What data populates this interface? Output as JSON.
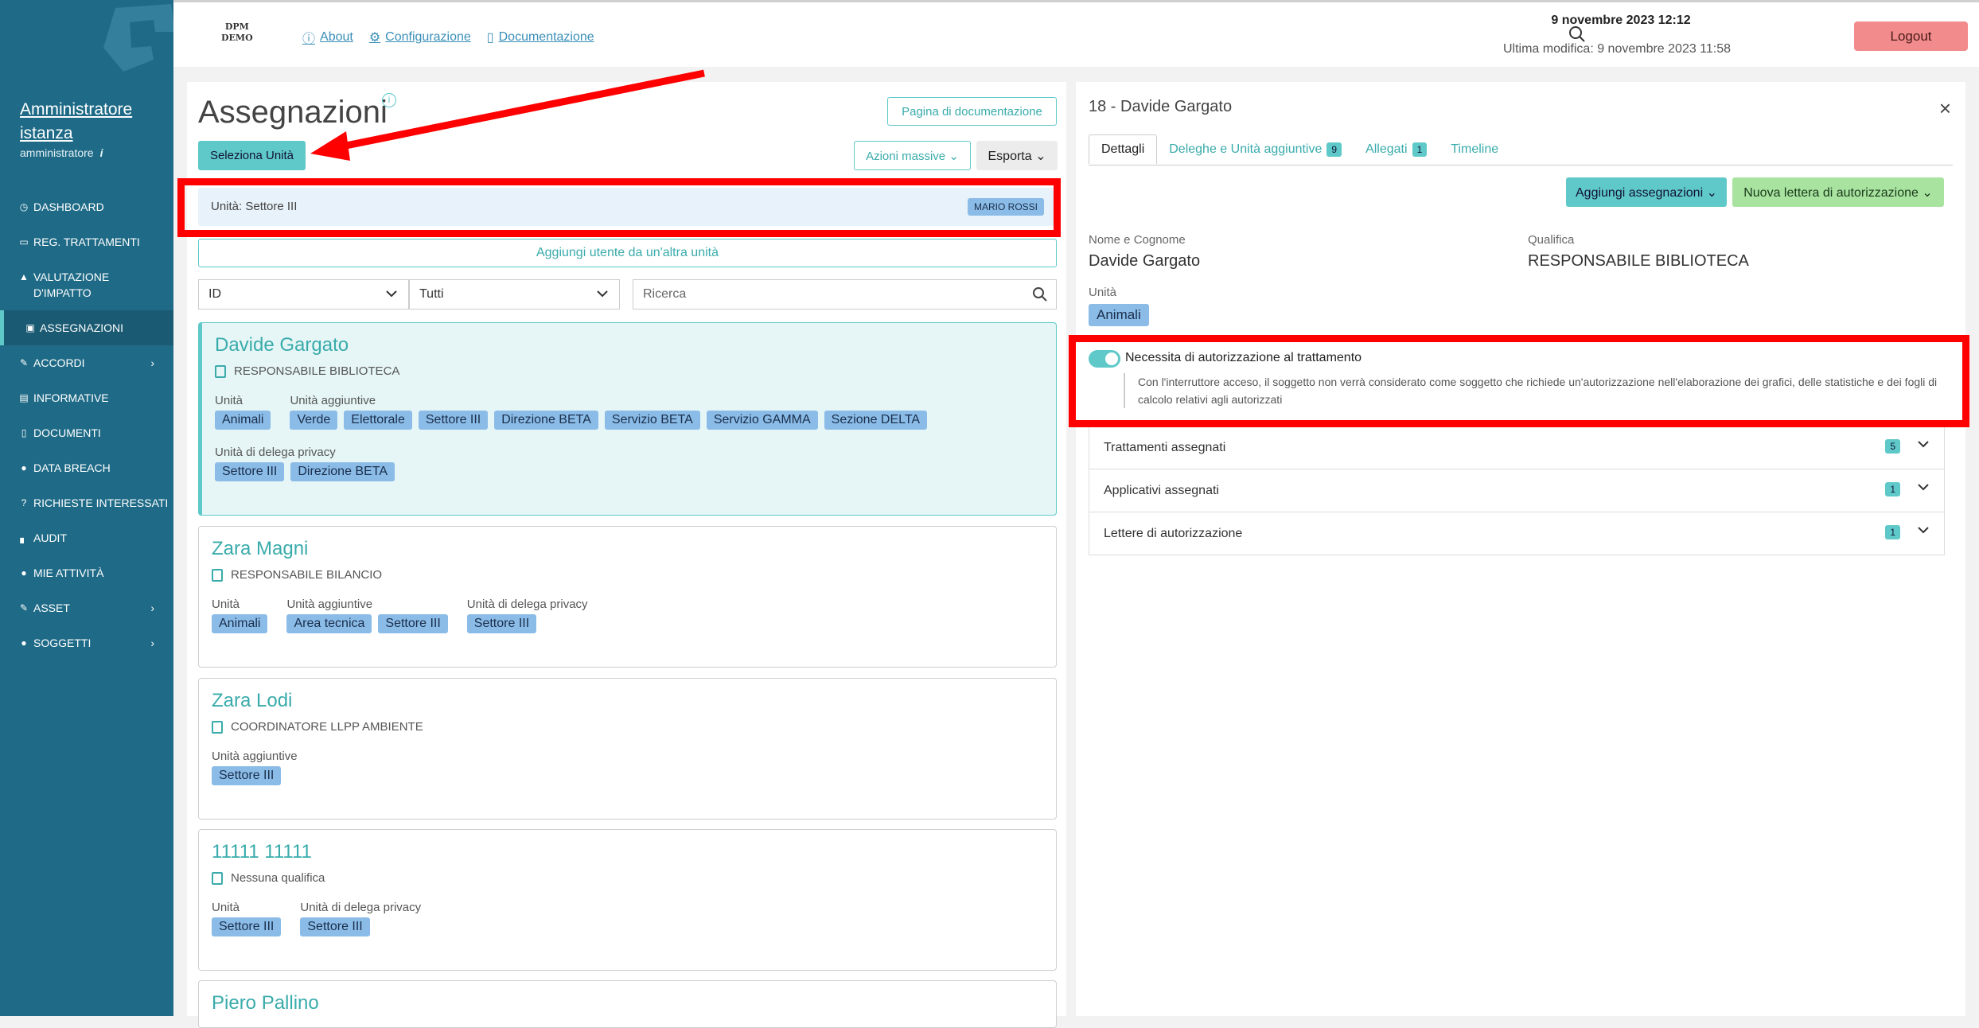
{
  "brand": {
    "line1": "DPM",
    "line2": "DEMO"
  },
  "topbar": {
    "links": [
      {
        "label": "About",
        "icon": "info-icon"
      },
      {
        "label": "Configurazione",
        "icon": "gear-icon"
      },
      {
        "label": "Documentazione",
        "icon": "book-icon"
      }
    ],
    "date": "9 novembre 2023 12:12",
    "last_modified": "Ultima modifica: 9 novembre 2023 11:58",
    "logout_label": "Logout"
  },
  "sidebar": {
    "user_name": "Amministratore istanza",
    "user_role": "amministratore",
    "user_info_icon": "i",
    "items": [
      {
        "label": "DASHBOARD",
        "icon": "dashboard-icon"
      },
      {
        "label": "REG. TRATTAMENTI",
        "icon": "book-icon"
      },
      {
        "label": "VALUTAZIONE D'IMPATTO",
        "icon": "warning-icon"
      },
      {
        "label": "ASSEGNAZIONI",
        "icon": "id-badge-icon",
        "active": true
      },
      {
        "label": "ACCORDI",
        "icon": "handshake-icon",
        "has_children": true
      },
      {
        "label": "INFORMATIVE",
        "icon": "document-icon"
      },
      {
        "label": "DOCUMENTI",
        "icon": "file-icon"
      },
      {
        "label": "DATA BREACH",
        "icon": "alert-icon"
      },
      {
        "label": "RICHIESTE INTERESSATI",
        "icon": "question-icon"
      },
      {
        "label": "AUDIT",
        "icon": "bar-chart-icon"
      },
      {
        "label": "MIE ATTIVITÀ",
        "icon": "person-icon"
      },
      {
        "label": "ASSET",
        "icon": "edit-icon",
        "has_children": true
      },
      {
        "label": "SOGGETTI",
        "icon": "users-icon",
        "has_children": true
      }
    ]
  },
  "left": {
    "title": "Assegnazioni",
    "title_info": "i",
    "doc_button": "Pagina di documentazione",
    "select_unit_button": "Seleziona Unità",
    "bulk_actions": "Azioni massive",
    "export": "Esporta",
    "unit_bar_text": "Unità: Settore III",
    "unit_bar_badge": "MARIO ROSSI",
    "add_user": "Aggiungi utente da un'altra unità",
    "filter_sort": "ID",
    "filter_all": "Tutti",
    "search_placeholder": "Ricerca",
    "cards": [
      {
        "name": "Davide Gargato",
        "qualifica": "RESPONSABILE BIBLIOTECA",
        "selected": true,
        "groups": [
          {
            "label": "Unità",
            "tags": [
              "Animali"
            ]
          },
          {
            "label": "Unità aggiuntive",
            "tags": [
              "Verde",
              "Elettorale",
              "Settore III",
              "Direzione BETA",
              "Servizio BETA",
              "Servizio GAMMA",
              "Sezione DELTA"
            ]
          },
          {
            "label": "Unità di delega privacy",
            "tags": [
              "Settore III",
              "Direzione BETA"
            ]
          }
        ]
      },
      {
        "name": "Zara Magni",
        "qualifica": "RESPONSABILE BILANCIO",
        "groups": [
          {
            "label": "Unità",
            "tags": [
              "Animali"
            ]
          },
          {
            "label": "Unità aggiuntive",
            "tags": [
              "Area tecnica",
              "Settore III"
            ]
          },
          {
            "label": "Unità di delega privacy",
            "tags": [
              "Settore III"
            ]
          }
        ]
      },
      {
        "name": "Zara Lodi",
        "qualifica": "COORDINATORE LLPP AMBIENTE",
        "groups": [
          {
            "label": "Unità aggiuntive",
            "tags": [
              "Settore III"
            ]
          }
        ]
      },
      {
        "name": "11111 11111",
        "qualifica": "Nessuna qualifica",
        "groups": [
          {
            "label": "Unità",
            "tags": [
              "Settore III"
            ]
          },
          {
            "label": "Unità di delega privacy",
            "tags": [
              "Settore III"
            ]
          }
        ]
      },
      {
        "name": "Piero Pallino",
        "qualifica": "",
        "groups": []
      }
    ]
  },
  "right": {
    "title": "18 - Davide Gargato",
    "close": "×",
    "tabs": [
      {
        "label": "Dettagli",
        "active": true
      },
      {
        "label": "Deleghe e Unità aggiuntive",
        "count": "9"
      },
      {
        "label": "Allegati",
        "count": "1"
      },
      {
        "label": "Timeline"
      }
    ],
    "add_assignments": "Aggiungi assegnazioni",
    "new_letter": "Nuova lettera di autorizzazione",
    "name_label": "Nome e Cognome",
    "name_value": "Davide Gargato",
    "qual_label": "Qualifica",
    "qual_value": "RESPONSABILE BIBLIOTECA",
    "unit_label": "Unità",
    "unit_value": "Animali",
    "toggle_label": "Necessita di autorizzazione al trattamento",
    "toggle_on": true,
    "toggle_desc": "Con l'interruttore acceso, il soggetto non verrà considerato come soggetto che richiede un'autorizzazione nell'elaborazione dei grafici, delle statistiche e dei fogli di calcolo relativi agli autorizzati",
    "accordions": [
      {
        "label": "Trattamenti assegnati",
        "count": "5"
      },
      {
        "label": "Applicativi assegnati",
        "count": "1"
      },
      {
        "label": "Lettere di autorizzazione",
        "count": "1"
      }
    ]
  },
  "colors": {
    "sidebar": "#1f6b87",
    "accent": "#5fc9c9",
    "tag": "#8bbce8",
    "logout": "#f28b8b",
    "annotation": "#ff0000"
  }
}
